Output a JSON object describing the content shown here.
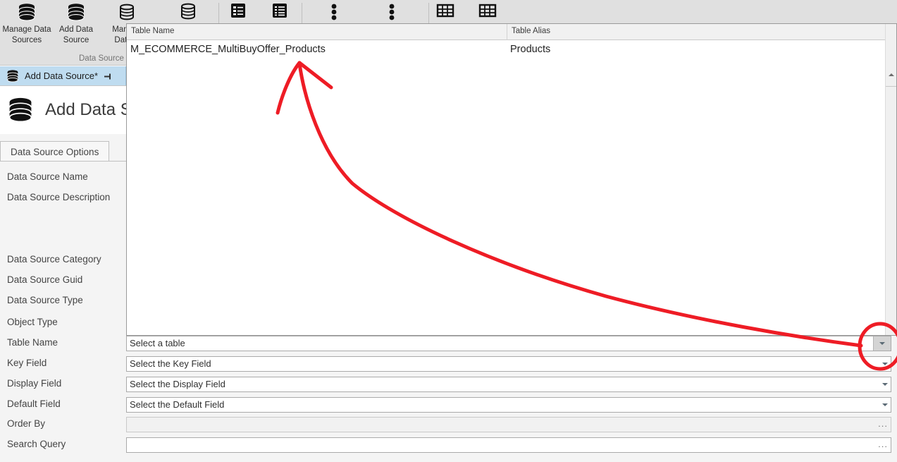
{
  "ribbon": {
    "buttons": [
      {
        "label_line1": "Manage Data",
        "label_line2": "Sources",
        "icon": "database-icon"
      },
      {
        "label_line1": "Add Data",
        "label_line2": "Source",
        "icon": "database-icon"
      },
      {
        "label_line1": "Manage",
        "label_line2": "Data S",
        "icon": "database-outline-icon"
      }
    ],
    "extra_icons": [
      {
        "icon": "database-outline-icon"
      },
      {
        "icon": "list-detail-icon"
      },
      {
        "icon": "list-detail-icon"
      },
      {
        "icon": "more-vertical-icon"
      },
      {
        "icon": "more-vertical-icon"
      },
      {
        "icon": "table-grid-icon"
      },
      {
        "icon": "table-grid-icon"
      }
    ],
    "group_title": "Data Source"
  },
  "tabstrip": {
    "document_tab": {
      "label": "Add Data Source*",
      "icon": "database-icon",
      "pin_icon": "pin-icon"
    }
  },
  "page_header": {
    "title": "Add Data Sou",
    "icon": "database-icon"
  },
  "tabs": {
    "options_tab": "Data Source Options"
  },
  "fields": [
    {
      "label": "Data Source Name",
      "type": "none"
    },
    {
      "label": "Data Source Description",
      "type": "none"
    },
    {
      "label": "Data Source Category",
      "type": "none"
    },
    {
      "label": "Data Source Guid",
      "type": "none"
    },
    {
      "label": "Data Source Type",
      "type": "none"
    },
    {
      "label": "Object Type",
      "type": "none"
    },
    {
      "label": "Table Name",
      "type": "combo",
      "value": "Select a table",
      "arrow": "chevron-down-icon"
    },
    {
      "label": "Key Field",
      "type": "combo",
      "value": "Select the Key Field",
      "arrow": "chevron-down-icon"
    },
    {
      "label": "Display Field",
      "type": "combo",
      "value": "Select the Display Field",
      "arrow": "chevron-down-icon"
    },
    {
      "label": "Default Field",
      "type": "combo",
      "value": "Select the Default Field",
      "arrow": "chevron-down-icon"
    },
    {
      "label": "Order By",
      "type": "text",
      "value": "",
      "ellipsis": "...",
      "disabled": true
    },
    {
      "label": "Search Query",
      "type": "text",
      "value": "",
      "ellipsis": "...",
      "disabled": false
    }
  ],
  "dropdown": {
    "columns": [
      "Table Name",
      "Table Alias"
    ],
    "rows": [
      {
        "table_name": "M_ECOMMERCE_MultiBuyOffer_Products",
        "table_alias": "Products"
      }
    ],
    "scrollbar_icon": "scroll-up-icon"
  },
  "annotation": {
    "color": "#ee1c25",
    "shapes": [
      "arrow-pointing-up",
      "circle-highlight"
    ]
  },
  "colors": {
    "ribbon_bg": "#e0e0e0",
    "tab_selected": "#bfdcf0",
    "panel_bg": "#f4f4f4",
    "annotation_red": "#ee1c25"
  }
}
